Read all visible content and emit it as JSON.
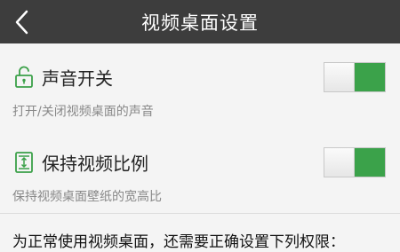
{
  "header": {
    "title": "视频桌面设置",
    "back_icon": "chevron-left-icon",
    "background": "#3d3d3d"
  },
  "settings": [
    {
      "title": "声音开关",
      "description": "打开/关闭视频桌面的声音",
      "icon": "unlock-icon",
      "enabled": true
    },
    {
      "title": "保持视频比例",
      "description": "保持视频桌面壁纸的宽高比",
      "icon": "aspect-ratio-icon",
      "enabled": true
    }
  ],
  "permissions_note": "为正常使用视频桌面，还需要正确设置下列权限：",
  "colors": {
    "accent": "#3ba24a",
    "icon_green": "#3aa048"
  }
}
